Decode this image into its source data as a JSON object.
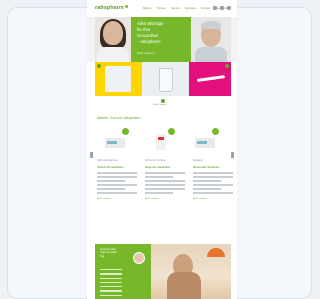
{
  "site": {
    "logo_text": "ratiopharm",
    "nav": [
      "Marken",
      "Themen",
      "Service",
      "Apotheke",
      "Karriere",
      "Unternehmen"
    ]
  },
  "hero": {
    "headline_lines": [
      "Alles Wichtige",
      "für Ihre",
      "Gesundheit",
      "– ratiopharm"
    ],
    "cta": "Mehr erfahren"
  },
  "tiles_link": "Mehr Themen",
  "section": {
    "title": "Aktuell: Gut von ratiopharm"
  },
  "products": [
    {
      "category": "Nahrungsergänzung",
      "name": "Vitamin D3 ratiopharm",
      "more": "Mehr erfahren"
    },
    {
      "category": "Schmerzen & Fieber",
      "name": "Ibuprofen ratiopharm",
      "more": "Mehr erfahren"
    },
    {
      "category": "Erkältung",
      "name": "Hustensaft ratiopharm",
      "more": "Mehr erfahren"
    }
  ],
  "bottom": {
    "title_lines": [
      "Gesund leben",
      "Tipps für jeden",
      "Tag"
    ]
  },
  "colors": {
    "brand_green": "#76b82a",
    "tile_yellow": "#ffd500",
    "tile_magenta": "#e30f7a"
  }
}
